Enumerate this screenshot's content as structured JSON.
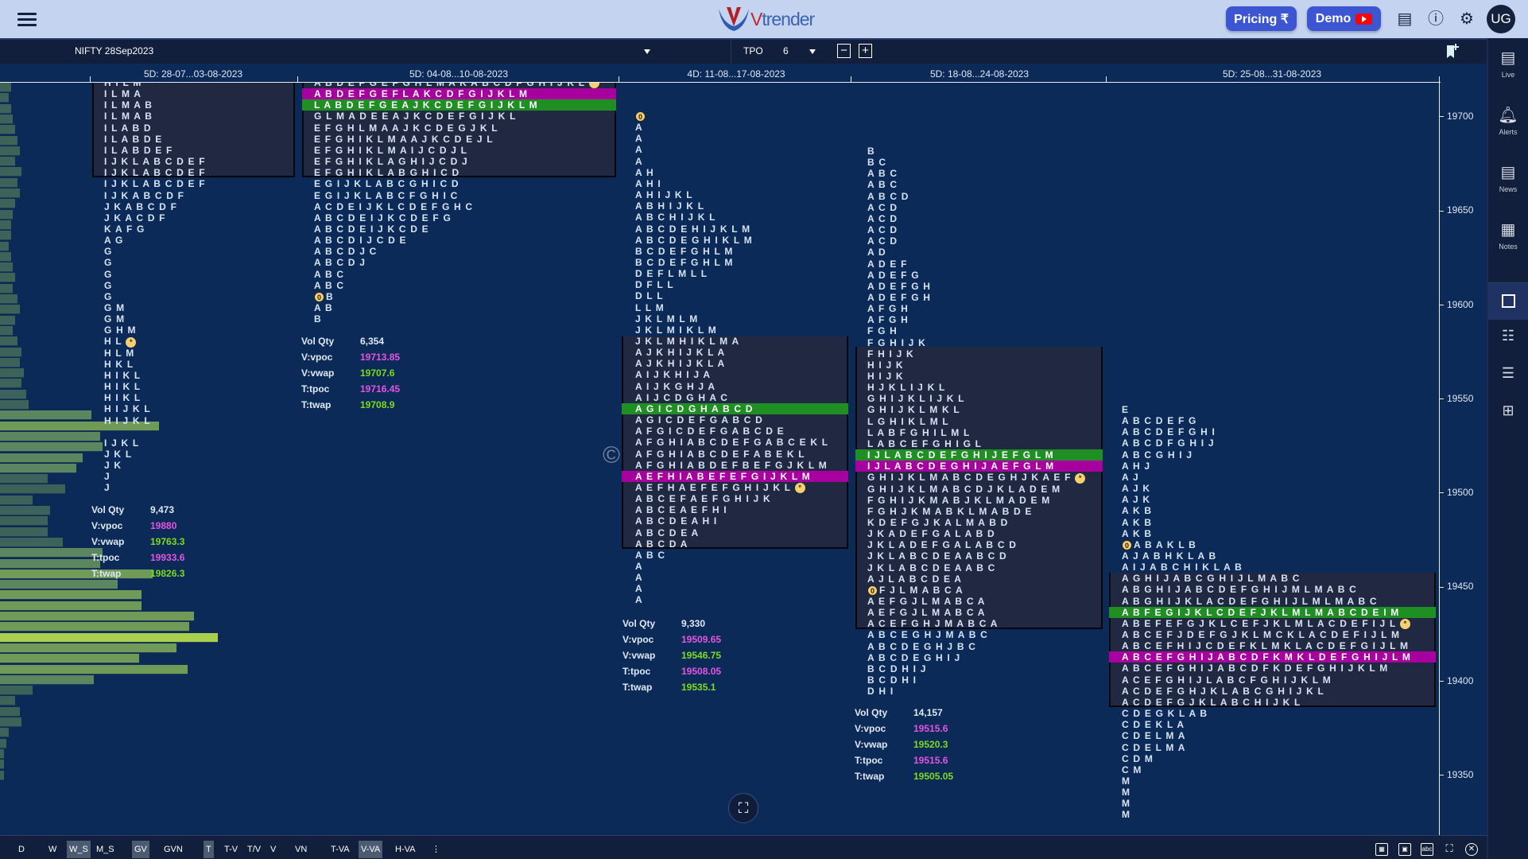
{
  "app": {
    "brand": "Vtrender",
    "brand_colors": {
      "accent": "#3b55d3",
      "chart_bg": "#0c2a57",
      "vpoc_row": "#a8009f",
      "vwap_row": "#1f8f24",
      "value_magenta": "#e455e4",
      "value_green": "#7ddc1f"
    }
  },
  "topbar": {
    "menu_icon": "hamburger-icon",
    "pricing_label": "Pricing ₹",
    "demo_label": "Demo",
    "icons": [
      "document-icon",
      "info-icon",
      "gear-icon"
    ],
    "avatar": "UG"
  },
  "toolbar": {
    "symbol": "NIFTY 28Sep2023",
    "mode_label": "TPO",
    "tpo_size": "6",
    "minus": "−",
    "plus": "+",
    "bookmark_icon": "bookmark-add-icon"
  },
  "price_axis": {
    "ticks": [
      19700,
      19650,
      19600,
      19550,
      19500,
      19450,
      19400,
      19350
    ]
  },
  "volume_profile": {
    "relative_volume": [
      0.05,
      0.04,
      0.05,
      0.06,
      0.07,
      0.08,
      0.09,
      0.07,
      0.1,
      0.08,
      0.09,
      0.07,
      0.06,
      0.05,
      0.05,
      0.04,
      0.05,
      0.06,
      0.07,
      0.06,
      0.08,
      0.09,
      0.07,
      0.06,
      0.08,
      0.1,
      0.09,
      0.11,
      0.1,
      0.12,
      0.13,
      0.42,
      0.73,
      0.46,
      0.47,
      0.38,
      0.35,
      0.22,
      0.3,
      0.15,
      0.23,
      0.22,
      0.22,
      0.29,
      0.47,
      0.46,
      0.7,
      0.54,
      0.65,
      0.65,
      0.89,
      0.87,
      1.0,
      0.81,
      0.64,
      0.86,
      0.43,
      0.15,
      0.07,
      0.09,
      0.1,
      0.04,
      0.03,
      0.02,
      0.02,
      0.02
    ]
  },
  "profiles": [
    {
      "header": "5D: 28-07...03-08-2023",
      "rows": [
        "H I L M",
        "I L M A",
        "I L M A B",
        "I L M A B",
        "I L A B D",
        "I L A B D E",
        "I L A B D E F",
        "I J K L A B C D E F",
        "I J K L A B C D E F",
        "I J K L A B C D E F",
        "I J K A B C D F",
        "J K A B C D F",
        "J K A C D F",
        "K A F G",
        "A G",
        "G",
        "G",
        "G",
        "G",
        "G",
        "G M",
        "G M",
        "G H M",
        "H L *",
        "H L M",
        "H K L",
        "H I K L",
        "H I K L",
        "H I K L",
        "H I J K L",
        "H I J K L",
        "",
        "I J K L",
        "J K L",
        "J K",
        "J",
        "J"
      ],
      "stats": [
        {
          "label": "Vol Qty",
          "value": "9,473",
          "color": "#dfe9f5"
        },
        {
          "label": "V:vpoc",
          "value": "19880",
          "color": "#e455e4"
        },
        {
          "label": "V:vwap",
          "value": "19763.3",
          "color": "#7ddc1f"
        },
        {
          "label": "T:tpoc",
          "value": "19933.6",
          "color": "#e455e4"
        },
        {
          "label": "T:twap",
          "value": "19826.3",
          "color": "#7ddc1f"
        }
      ]
    },
    {
      "header": "5D: 04-08...10-08-2023",
      "rows": [
        "A B D E F G E F G H L M A K A B C D F G H I J K L *",
        {
          "t": "A B D E F G E F L A K C D F G I J K L M",
          "hl": "magenta"
        },
        {
          "t": "L A B D E F G E A J K C D E F G I J K L M",
          "hl": "green"
        },
        "G L M A D E E A J K C D E F G I J K L",
        "E F G H L M A A J K C D E G J K L",
        "E F G H I K L M A A J K C D E J L",
        "E F G H I K L M A I J C D J L",
        "E F G H I K L A G H I J C D J",
        "E F G H I K L A B G H I C D",
        "E G I J K L A B C G H I C D",
        "E G I J K L A B C F G H I C",
        "A C D E I J K L C D E F G H C",
        "A B C D E I J K C D E F G",
        "A B C D E I J K C D E",
        "A B C D I J C D E",
        "A B C D J C",
        "A B C D J",
        "A B C",
        "A B C",
        "0 B",
        "A B",
        "B"
      ],
      "stats": [
        {
          "label": "Vol Qty",
          "value": "6,354",
          "color": "#dfe9f5"
        },
        {
          "label": "V:vpoc",
          "value": "19713.85",
          "color": "#e455e4"
        },
        {
          "label": "V:vwap",
          "value": "19707.6",
          "color": "#7ddc1f"
        },
        {
          "label": "T:tpoc",
          "value": "19716.45",
          "color": "#e455e4"
        },
        {
          "label": "T:twap",
          "value": "19708.9",
          "color": "#7ddc1f"
        }
      ]
    },
    {
      "header": "4D: 11-08...17-08-2023",
      "rows": [
        "0",
        "A",
        "A",
        "A",
        "A",
        "A H",
        "A H I",
        "A H I J K L",
        "A B H I J K L",
        "A B C H I J K L",
        "A B C D E H I J K L M",
        "A B C D E G H I K L M",
        "B C D E F G H L M",
        "B C D E F G H L M",
        "D E F L M L L",
        "D F L L",
        "D L L",
        "L L M",
        "J K L M L M",
        "J K L M I K L M",
        "J K L M H I K L M A",
        "A J K H I J K L A",
        "A J K H I J K L A",
        "A I J K H I J A",
        "A I J K G H J A",
        "A I J C D G H A C",
        {
          "t": "A G I C D G H A B C D",
          "hl": "green"
        },
        "A G I C D E F G A B C D",
        "A F G I C D E F G A B C D E",
        "A F G H I A B C D E F G A B C E K L",
        "A F G H I A B C D E F A B E K L",
        "A F G H I A B D E F B E F G J K L M",
        {
          "t": "A E F H I A B E F E F G I J K L M",
          "hl": "magenta"
        },
        "A E F H A E F E F G H I J K L *",
        "A B C E F A E F G H I J K",
        "A B C E A E F H I",
        "A B C D E A H I",
        "A B C D E A",
        "A B C D A",
        "A B C",
        "A",
        "A",
        "A",
        "A"
      ],
      "stats": [
        {
          "label": "Vol Qty",
          "value": "9,330",
          "color": "#dfe9f5"
        },
        {
          "label": "V:vpoc",
          "value": "19509.65",
          "color": "#e455e4"
        },
        {
          "label": "V:vwap",
          "value": "19546.75",
          "color": "#7ddc1f"
        },
        {
          "label": "T:tpoc",
          "value": "19508.05",
          "color": "#e455e4"
        },
        {
          "label": "T:twap",
          "value": "19535.1",
          "color": "#7ddc1f"
        }
      ]
    },
    {
      "header": "5D: 18-08...24-08-2023",
      "rows": [
        "B",
        "B C",
        "A B C",
        "A B C",
        "A B C D",
        "A C D",
        "A C D",
        "A C D",
        "A C D",
        "A D",
        "A D E F",
        "A D E F G",
        "A D E F G H",
        "A D E F G H",
        "A F G H",
        "A F G H",
        "F G H",
        "F G H I J K",
        "F H I J K",
        "H I J K",
        "H I J K",
        "H J K L I J K L",
        "G H I J K L I J K L",
        "G H I J K L M K L",
        "L G H I K L M L",
        "L A B F G H I L M L",
        "L A B C E F G H I G L",
        {
          "t": "I J L A B C D E F G H I J E F G L M",
          "hl": "green"
        },
        {
          "t": "I J L A B C D E G H I J A E F G L M",
          "hl": "magenta"
        },
        "G H I J K L M A B C D E G H J K A E F *",
        "G H I J K L M A B C D J K L A D E M",
        "F G H I J K M A B J K L M A D E M",
        "F G H J K M A B K L M A B D E",
        "K D E F G J K A L M A B D",
        "J K A D E F G A L A B D",
        "J K L A D E F G A L A B C D",
        "J K L A B C D E A A B C D",
        "J K L A B C D E A A B C",
        "A J L A B C D E A",
        "0 F J L M A B C A",
        "A E F G J L M A B C A",
        "A E F G J L M A B C A",
        "A C E F G H J M A B C A",
        "A B C E G H J M A B C",
        "A B C D E G H J B C",
        "A B C D E G H I J",
        "B C D H I J",
        "B C D H I",
        "D H I"
      ],
      "stats": [
        {
          "label": "Vol Qty",
          "value": "14,157",
          "color": "#dfe9f5"
        },
        {
          "label": "V:vpoc",
          "value": "19515.6",
          "color": "#e455e4"
        },
        {
          "label": "V:vwap",
          "value": "19520.3",
          "color": "#7ddc1f"
        },
        {
          "label": "T:tpoc",
          "value": "19515.6",
          "color": "#e455e4"
        },
        {
          "label": "T:twap",
          "value": "19505.05",
          "color": "#7ddc1f"
        }
      ]
    },
    {
      "header": "5D: 25-08...31-08-2023",
      "rows": [
        "E",
        "A B C D E F G",
        "A B C D E F G H I",
        "A B C D F G H I J",
        "A B C G H I J",
        "A H J",
        "A J",
        "A J K",
        "A J K",
        "A K B",
        "A K B",
        "A K B",
        "0 A B A K L B",
        "A J A B H K L A B",
        "A I J A B C H I K L A B",
        "A G H I J A B C G H I J L M A B C",
        "A B G H I J A B C D E F G H I J M L M A B C",
        "A B G H I J K L A C D E F G H I J L M L M A B C",
        {
          "t": "A B F E G I J K L C D E F J K L M L M A B C D E I M",
          "hl": "green"
        },
        "A B E F E F G J K L C E F J K L M L A C D E F I J L *",
        "A B C E F J D E F G J K L M C K L A C D E F I J L M",
        "A B C E F H I J C D E F K L M K L A C D E F G I J L M",
        {
          "t": "A B C E F G H I J A B C D F K M K L D E F G H I J L M",
          "hl": "magenta"
        },
        "A B C E F G H I J A B C D F K D E F G H I J K L M",
        "A C E F G H I J L A B C F G H I J K L M",
        "A C D E F G H J K L A B C G H I J K L",
        "A C D E F G J K L A B C H I J K L",
        "C D E G K L A B",
        "C D E K L A",
        "C D E L M A",
        "C D E L M A",
        "C D M",
        "C M",
        "M",
        "M",
        "M",
        "M"
      ],
      "stats": []
    }
  ],
  "watermark": "©",
  "screenshot_icon": "screenshot-icon",
  "sidebar": {
    "items": [
      {
        "label": "Live",
        "icon": "live-document-icon"
      },
      {
        "label": "Alerts",
        "icon": "bell-plus-icon"
      },
      {
        "label": "News",
        "icon": "news-icon"
      },
      {
        "label": "Notes",
        "icon": "notes-icon"
      }
    ],
    "layouts": [
      "single-pane-icon",
      "split-pane-icon",
      "rows-icon",
      "grid-icon"
    ]
  },
  "bottombar": {
    "items": [
      {
        "label": "D",
        "on": false
      },
      {
        "label": "W",
        "on": false
      },
      {
        "label": "W_S",
        "on": true
      },
      {
        "label": "M_S",
        "on": false
      },
      {
        "label": "GV",
        "on": true
      },
      {
        "label": "GVN",
        "on": false
      },
      {
        "label": "T",
        "on": true
      },
      {
        "label": "T-V",
        "on": false
      },
      {
        "label": "T/V",
        "on": false
      },
      {
        "label": "V",
        "on": false
      },
      {
        "label": "VN",
        "on": false
      },
      {
        "label": "T-VA",
        "on": false
      },
      {
        "label": "V-VA",
        "on": true
      },
      {
        "label": "H-VA",
        "on": false
      },
      {
        "label": "⋮",
        "on": false
      }
    ],
    "right_icons": [
      "grid-table-icon",
      "image-icon",
      "abc-icon",
      "fullscreen-icon",
      "close-circle-icon"
    ]
  }
}
